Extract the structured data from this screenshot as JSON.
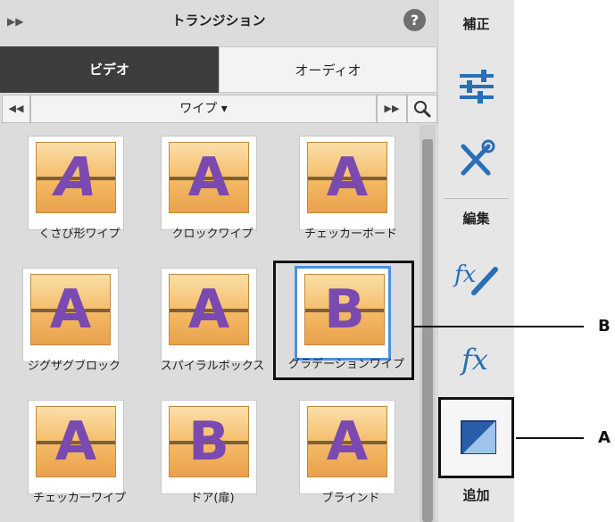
{
  "panel": {
    "title": "トランジション",
    "collapse_icon": "double-chevron-right",
    "help_icon": "?",
    "tabs": [
      {
        "label": "ビデオ",
        "active": true
      },
      {
        "label": "オーディオ",
        "active": false
      }
    ],
    "category": {
      "value": "ワイプ ▾",
      "prev_icon": "◀◀",
      "next_icon": "▶▶",
      "search_icon": "magnifier"
    },
    "items": [
      {
        "label": "くさび形ワイプ",
        "letter": "A"
      },
      {
        "label": "クロックワイプ",
        "letter": "A"
      },
      {
        "label": "チェッカーボード",
        "letter": "A"
      },
      {
        "label": "ジグザグブロック",
        "letter": "A"
      },
      {
        "label": "スパイラルボックス",
        "letter": "A"
      },
      {
        "label": "グラデーションワイプ",
        "letter": "B",
        "selected": true
      },
      {
        "label": "チェッカーワイプ",
        "letter": "A"
      },
      {
        "label": "ドア(扉)",
        "letter": "B"
      },
      {
        "label": "ブラインド",
        "letter": "A"
      }
    ]
  },
  "toolbar": {
    "correct_label": "補正",
    "edit_label": "編集",
    "add_label": "追加"
  },
  "callouts": {
    "a": "A",
    "b": "B"
  },
  "colors": {
    "accent": "#4d8fde",
    "active_tab": "#3d3d3d",
    "letter": "#7a4ab0"
  }
}
